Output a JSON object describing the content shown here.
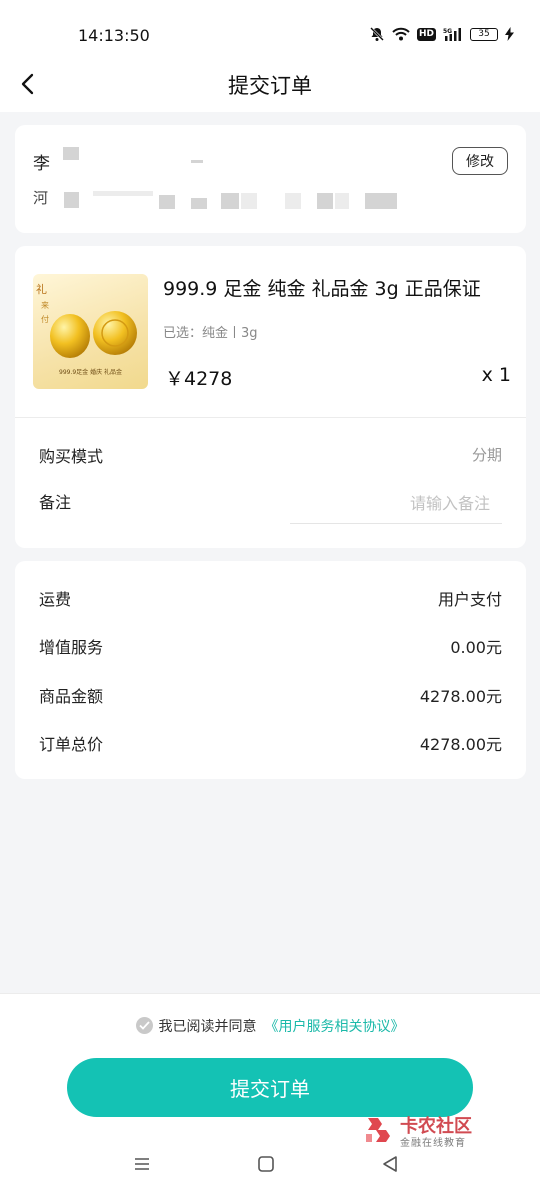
{
  "status_bar": {
    "time": "14:13:50",
    "hd": "HD",
    "network": "5G",
    "battery": "35",
    "icons": [
      "mute-icon",
      "wifi-icon",
      "signal-icon",
      "battery-icon",
      "charging-icon"
    ]
  },
  "nav": {
    "title": "提交订单",
    "back_icon": "back-chevron-icon"
  },
  "address": {
    "name": "李",
    "detail": "河",
    "edit_label": "修改"
  },
  "product": {
    "name": "999.9 足金 纯金 礼品金 3g 正品保证",
    "spec": "已选：纯金丨3g",
    "price": "￥4278",
    "quantity": "x 1",
    "image_caption": "999.9足金 婚庆 礼品金"
  },
  "purchase": {
    "mode_label": "购买模式",
    "mode_value": "分期",
    "remark_label": "备注",
    "remark_placeholder": "请输入备注"
  },
  "fees": [
    {
      "label": "运费",
      "value": "用户支付"
    },
    {
      "label": "增值服务",
      "value": "0.00元"
    },
    {
      "label": "商品金额",
      "value": "4278.00元"
    },
    {
      "label": "订单总价",
      "value": "4278.00元"
    }
  ],
  "agreement": {
    "text": "我已阅读并同意",
    "link": "《用户服务相关协议》"
  },
  "submit_label": "提交订单",
  "watermark": {
    "title": "卡农社区",
    "subtitle": "金融在线教育"
  },
  "colors": {
    "accent": "#14c2b4",
    "link": "#1bb9a9",
    "background": "#f4f5f7"
  }
}
